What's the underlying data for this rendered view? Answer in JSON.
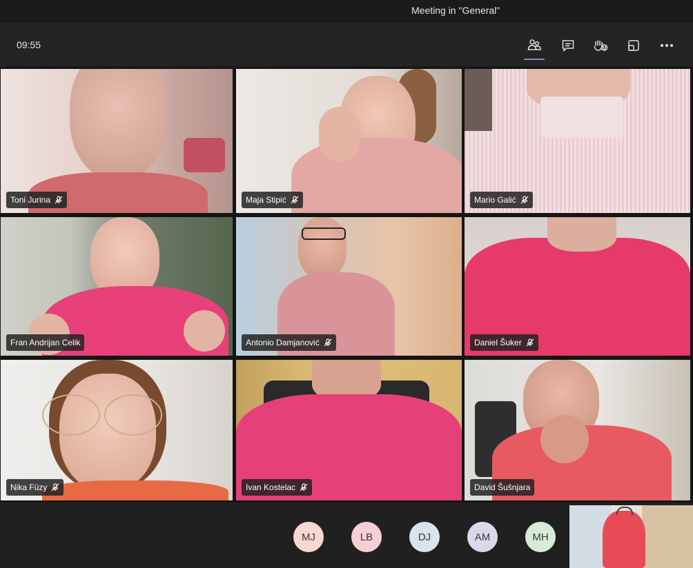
{
  "window": {
    "title": "Meeting in \"General\""
  },
  "toolbar": {
    "time": "09:55",
    "buttons": [
      {
        "name": "participants-icon"
      },
      {
        "name": "chat-icon"
      },
      {
        "name": "raise-hand-icon"
      },
      {
        "name": "rooms-icon"
      },
      {
        "name": "more-icon"
      }
    ]
  },
  "participants": [
    {
      "name": "Toni Jurina",
      "muted": true
    },
    {
      "name": "Maja Stipić",
      "muted": true
    },
    {
      "name": "Mario Galić",
      "muted": true
    },
    {
      "name": "Fran Andrijan Celik",
      "muted": false
    },
    {
      "name": "Antonio Damjanović",
      "muted": true
    },
    {
      "name": "Daniel Šuker",
      "muted": true
    },
    {
      "name": "Nika Füzy",
      "muted": true
    },
    {
      "name": "Ivan Kostelac",
      "muted": true
    },
    {
      "name": "David Šušnjara",
      "muted": false
    }
  ],
  "overflow_avatars": [
    {
      "initials": "MJ",
      "color": "#f6d8d0"
    },
    {
      "initials": "LB",
      "color": "#f6cfd4"
    },
    {
      "initials": "DJ",
      "color": "#d8e4ec"
    },
    {
      "initials": "AM",
      "color": "#dcd8ec"
    },
    {
      "initials": "MH",
      "color": "#d6ecd8"
    }
  ],
  "colors": {
    "accent": "#8b8cc7",
    "shirt_pink": "#e8446a"
  }
}
